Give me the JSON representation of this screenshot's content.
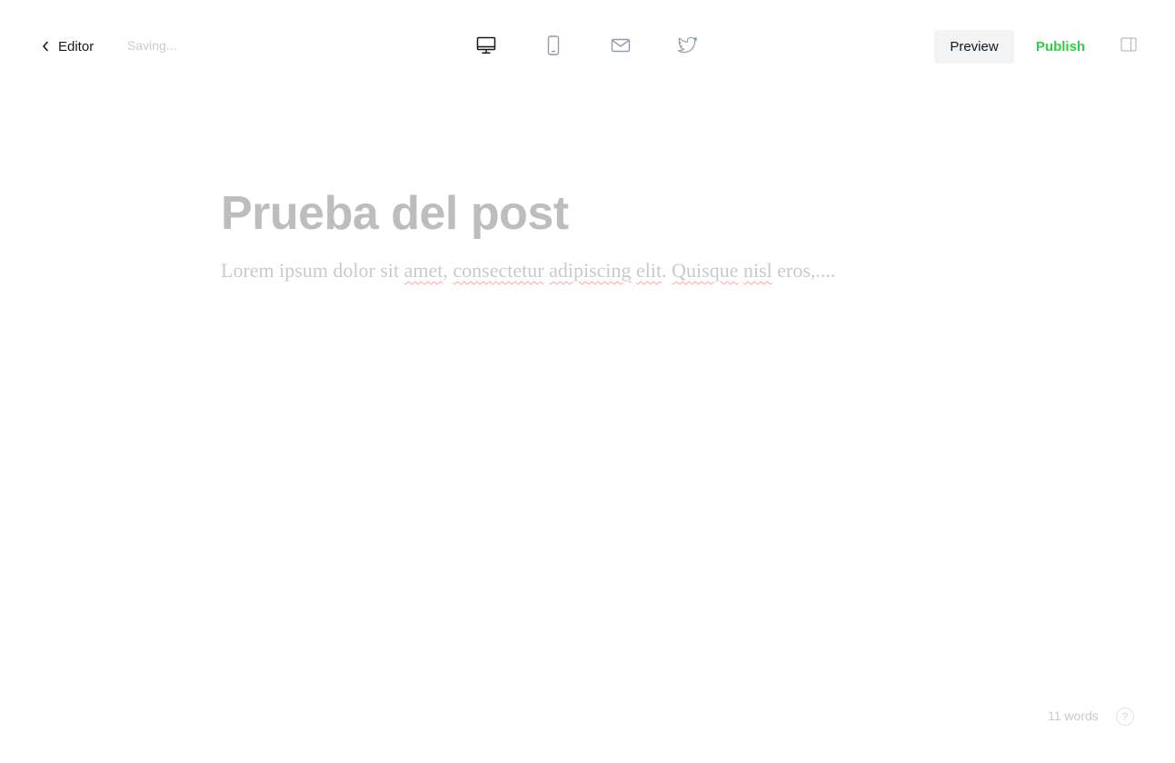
{
  "header": {
    "back_label": "Editor",
    "status_text": "Saving...",
    "device_toggles": [
      {
        "name": "desktop",
        "icon": "desktop-icon"
      },
      {
        "name": "mobile",
        "icon": "mobile-icon"
      },
      {
        "name": "email",
        "icon": "mail-icon"
      },
      {
        "name": "twitter",
        "icon": "twitter-icon"
      }
    ],
    "preview_label": "Preview",
    "publish_label": "Publish",
    "sidebar_toggle_icon": "sidebar-icon"
  },
  "post": {
    "title": "Prueba del post",
    "body_segments": [
      {
        "text": "Lorem ipsum dolor sit ",
        "misspelled": false
      },
      {
        "text": "amet",
        "misspelled": true
      },
      {
        "text": ", ",
        "misspelled": false
      },
      {
        "text": "consectetur",
        "misspelled": true
      },
      {
        "text": " ",
        "misspelled": false
      },
      {
        "text": "adipiscing",
        "misspelled": true
      },
      {
        "text": " ",
        "misspelled": false
      },
      {
        "text": "elit",
        "misspelled": true
      },
      {
        "text": ". ",
        "misspelled": false
      },
      {
        "text": "Quisque",
        "misspelled": true
      },
      {
        "text": " ",
        "misspelled": false
      },
      {
        "text": "nisl",
        "misspelled": true
      },
      {
        "text": " eros,....",
        "misspelled": false
      }
    ]
  },
  "footer": {
    "word_count": "11 words",
    "help_label": "?"
  },
  "colors": {
    "publish": "#30cf43",
    "title_placeholder": "#bdbdbd",
    "body_text": "#c9c9c9",
    "spellcheck_underline": "#f2a5a5"
  }
}
